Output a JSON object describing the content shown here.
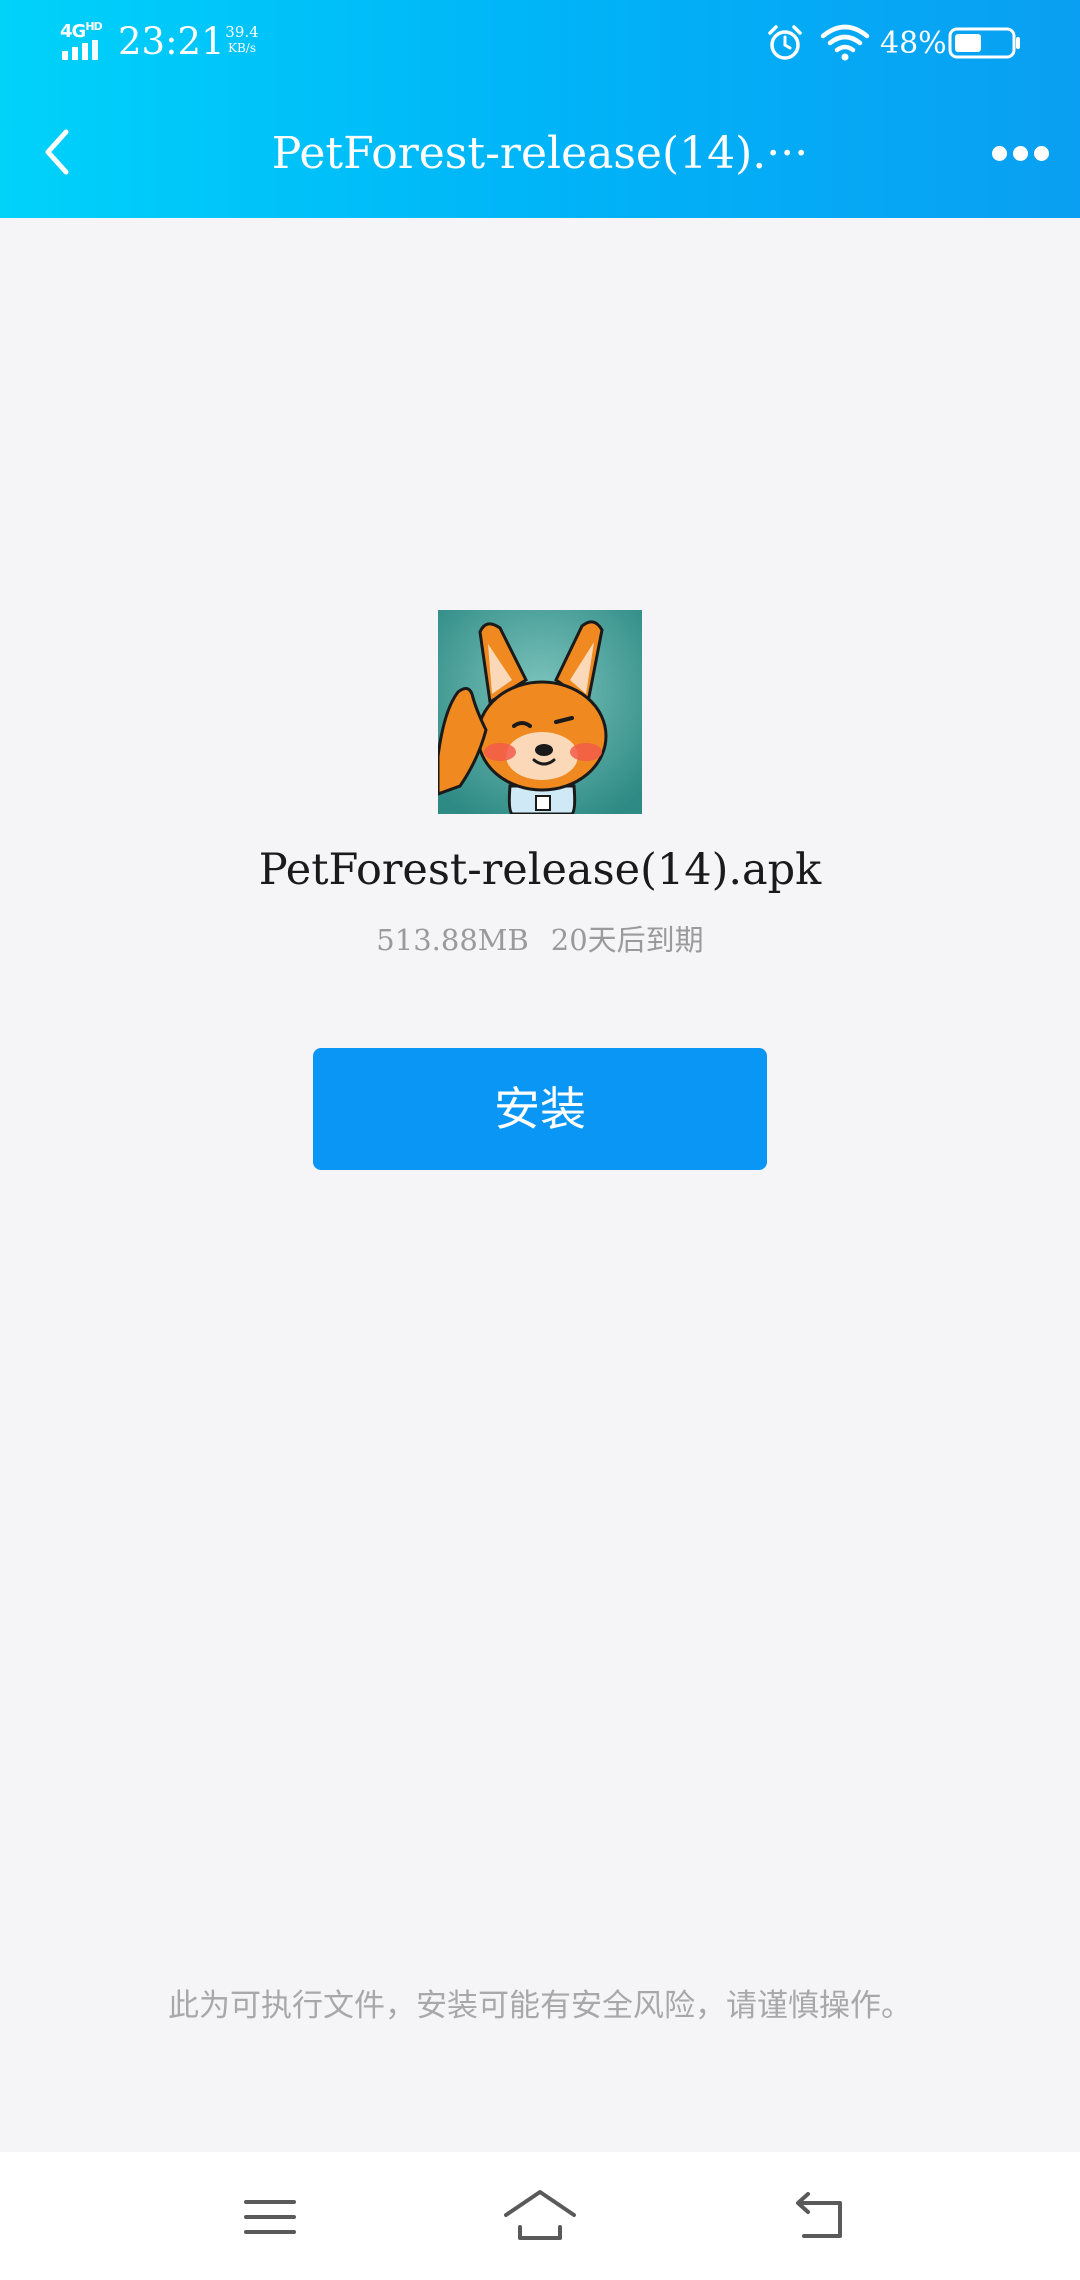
{
  "status_bar": {
    "network_type": "4G",
    "network_sub": "HD",
    "time": "23:21",
    "net_speed_value": "39.4",
    "net_speed_unit": "KB/s",
    "battery_percent": "48%",
    "battery_level": 0.48,
    "icons": [
      "signal-icon",
      "alarm-icon",
      "wifi-icon",
      "battery-icon"
    ]
  },
  "header": {
    "title": "PetForest-release(14).···",
    "back_icon": "chevron-left-icon",
    "more_icon": "more-icon"
  },
  "file": {
    "name": "PetForest-release(14).apk",
    "size": "513.88MB",
    "expiry": "20天后到期"
  },
  "actions": {
    "install_label": "安装"
  },
  "notice": {
    "text": "此为可执行文件，安装可能有安全风险，请谨慎操作。"
  },
  "system_nav": {
    "icons": [
      "menu-icon",
      "home-icon",
      "back-icon"
    ]
  },
  "colors": {
    "header_gradient_start": "#00d2fa",
    "header_gradient_end": "#0a9ff2",
    "install_button": "#0a96f5",
    "background": "#f5f5f7"
  }
}
